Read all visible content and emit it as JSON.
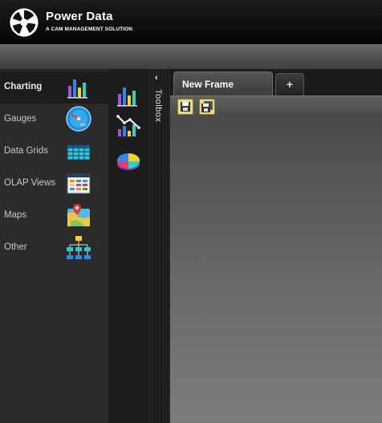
{
  "brand": {
    "title": "Power Data",
    "subtitle": "A CAM MANAGEMENT SOLUTION"
  },
  "categories": [
    {
      "label": "Charting",
      "icon": "bar-chart-icon",
      "active": true
    },
    {
      "label": "Gauges",
      "icon": "gauge-icon",
      "active": false
    },
    {
      "label": "Data Grids",
      "icon": "data-grid-icon",
      "active": false
    },
    {
      "label": "OLAP Views",
      "icon": "olap-view-icon",
      "active": false
    },
    {
      "label": "Maps",
      "icon": "map-icon",
      "active": false
    },
    {
      "label": "Other",
      "icon": "org-chart-icon",
      "active": false
    }
  ],
  "toolbox": {
    "label": "Toolbox",
    "collapse_glyph": "‹",
    "items": [
      "bar-chart-icon",
      "line-chart-icon",
      "pie-chart-icon"
    ]
  },
  "tabs": {
    "items": [
      {
        "label": "New Frame"
      }
    ],
    "add_label": "+"
  },
  "frame_toolbar": {
    "buttons": [
      "save-icon",
      "save-as-icon"
    ]
  },
  "colors": {
    "header": "#0a0a0a",
    "category_panel": "#2b2b2b",
    "active_category": "#1c1c1c",
    "save_button": "#e8dc87"
  }
}
